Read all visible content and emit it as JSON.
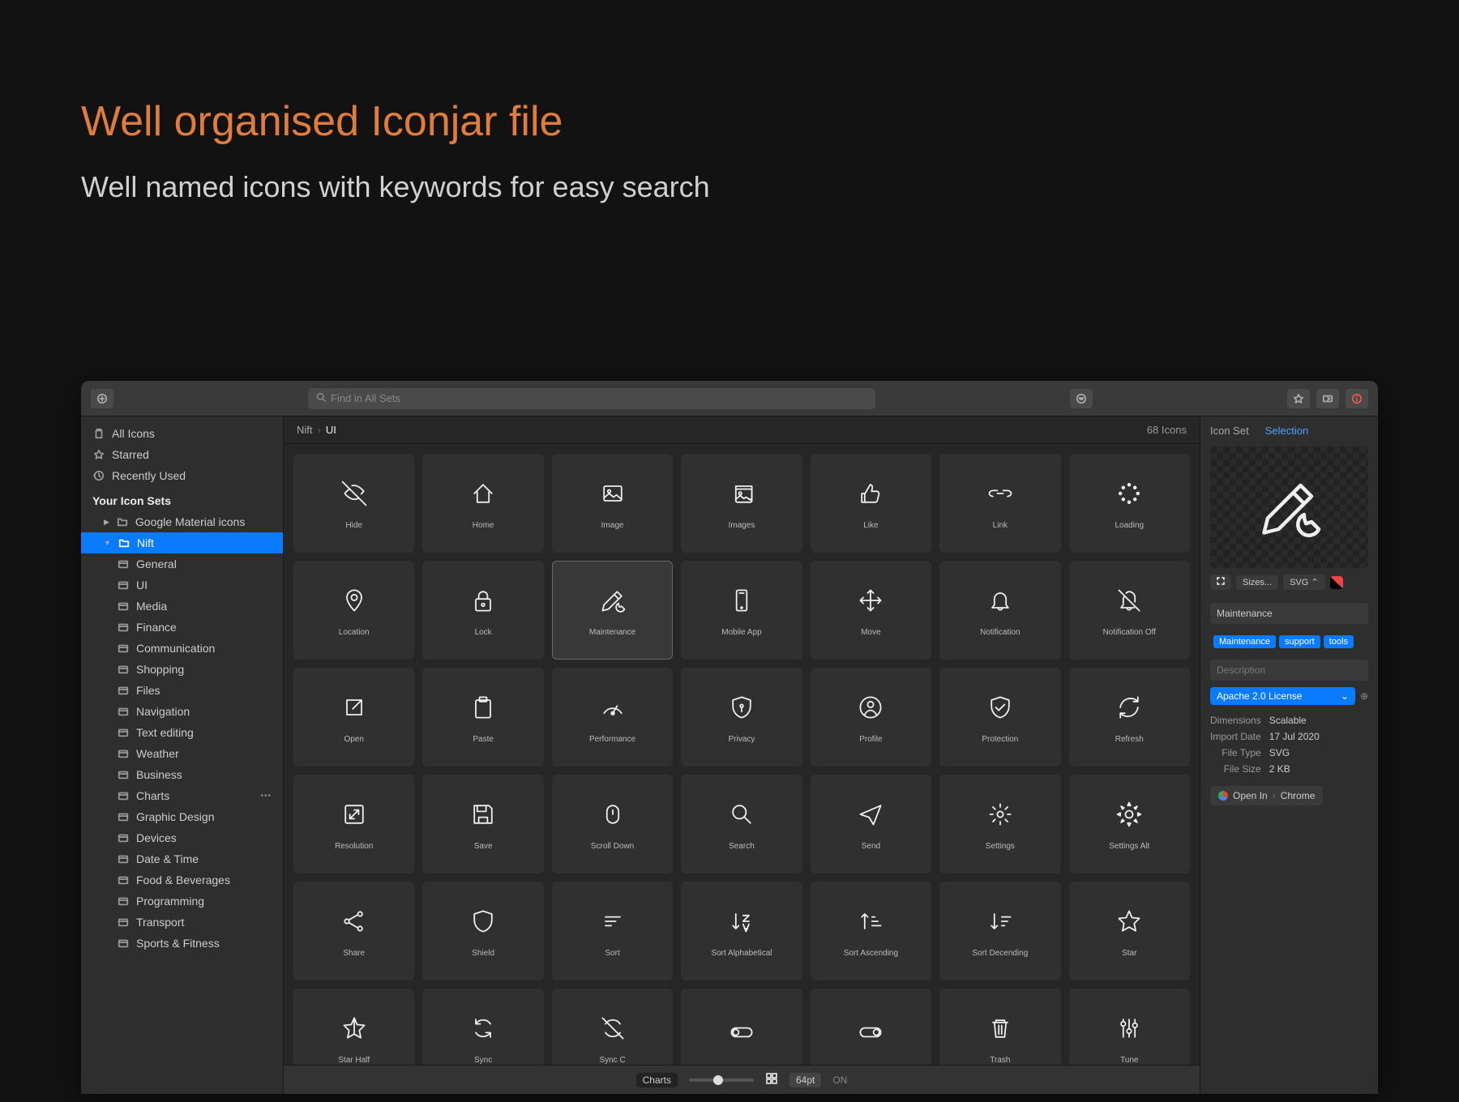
{
  "hero": {
    "title": "Well organised Iconjar file",
    "sub": "Well named icons with keywords for easy search"
  },
  "toolbar": {
    "search_placeholder": "Find in All Sets"
  },
  "sidebar": {
    "all": "All Icons",
    "starred": "Starred",
    "recent": "Recently Used",
    "header": "Your Icon Sets",
    "gmi": "Google Material icons",
    "nift": "Nift",
    "subs": [
      "General",
      "UI",
      "Media",
      "Finance",
      "Communication",
      "Shopping",
      "Files",
      "Navigation",
      "Text editing",
      "Weather",
      "Business",
      "Charts",
      "Graphic Design",
      "Devices",
      "Date & Time",
      "Food & Beverages",
      "Programming",
      "Transport",
      "Sports & Fitness"
    ]
  },
  "breadcrumb": {
    "root": "Nift",
    "leaf": "UI",
    "count": "68 Icons"
  },
  "icons": [
    {
      "label": "Hide",
      "svg": "eye-off"
    },
    {
      "label": "Home",
      "svg": "home"
    },
    {
      "label": "Image",
      "svg": "image"
    },
    {
      "label": "Images",
      "svg": "images"
    },
    {
      "label": "Like",
      "svg": "thumb"
    },
    {
      "label": "Link",
      "svg": "link"
    },
    {
      "label": "Loading",
      "svg": "loading"
    },
    {
      "label": "Location",
      "svg": "pin"
    },
    {
      "label": "Lock",
      "svg": "lock"
    },
    {
      "label": "Maintenance",
      "svg": "tools",
      "selected": true
    },
    {
      "label": "Mobile App",
      "svg": "mobile"
    },
    {
      "label": "Move",
      "svg": "move"
    },
    {
      "label": "Notification",
      "svg": "bell"
    },
    {
      "label": "Notification Off",
      "svg": "bell-off"
    },
    {
      "label": "Open",
      "svg": "external"
    },
    {
      "label": "Paste",
      "svg": "clipboard"
    },
    {
      "label": "Performance",
      "svg": "gauge"
    },
    {
      "label": "Privacy",
      "svg": "shield-key"
    },
    {
      "label": "Profile",
      "svg": "user"
    },
    {
      "label": "Protection",
      "svg": "shield-check"
    },
    {
      "label": "Refresh",
      "svg": "refresh"
    },
    {
      "label": "Resolution",
      "svg": "expand"
    },
    {
      "label": "Save",
      "svg": "save"
    },
    {
      "label": "Scroll Down",
      "svg": "mouse"
    },
    {
      "label": "Search",
      "svg": "search"
    },
    {
      "label": "Send",
      "svg": "send"
    },
    {
      "label": "Settings",
      "svg": "gear"
    },
    {
      "label": "Settings Alt",
      "svg": "gear-alt"
    },
    {
      "label": "Share",
      "svg": "share"
    },
    {
      "label": "Shield",
      "svg": "shield"
    },
    {
      "label": "Sort",
      "svg": "sort"
    },
    {
      "label": "Sort Alphabetical",
      "svg": "sort-az"
    },
    {
      "label": "Sort Ascending",
      "svg": "sort-asc"
    },
    {
      "label": "Sort Decending",
      "svg": "sort-desc"
    },
    {
      "label": "Star",
      "svg": "star"
    },
    {
      "label": "Star Half",
      "svg": "star-half"
    },
    {
      "label": "Sync",
      "svg": "sync"
    },
    {
      "label": "Sync C",
      "svg": "sync-c"
    },
    {
      "label": "",
      "svg": "toggle-off"
    },
    {
      "label": "",
      "svg": "toggle-on"
    },
    {
      "label": "Trash",
      "svg": "trash"
    },
    {
      "label": "Tune",
      "svg": "tune"
    }
  ],
  "footer": {
    "tooltip": "Charts",
    "size": "64pt",
    "on": "ON"
  },
  "inspector": {
    "tab1": "Icon Set",
    "tab2": "Selection",
    "sizes": "Sizes...",
    "svg": "SVG",
    "name": "Maintenance",
    "tags": [
      "Maintenance",
      "support",
      "tools"
    ],
    "desc_placeholder": "Description",
    "license": "Apache 2.0 License",
    "meta": {
      "dim_k": "Dimensions",
      "dim_v": "Scalable",
      "imp_k": "Import Date",
      "imp_v": "17 Jul 2020",
      "ft_k": "File Type",
      "ft_v": "SVG",
      "fs_k": "File Size",
      "fs_v": "2 KB"
    },
    "openin": "Open In",
    "chrome": "Chrome"
  }
}
